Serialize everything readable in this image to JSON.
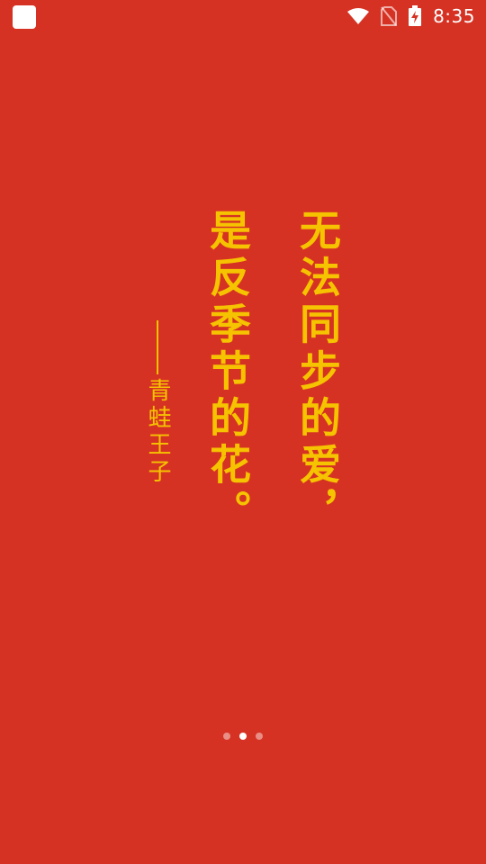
{
  "status_bar": {
    "time": "8:35",
    "icons": [
      "app-square-icon",
      "wifi-icon",
      "no-sim-icon",
      "battery-charging-icon"
    ]
  },
  "poem": {
    "line1": "无法同步的爱，",
    "line2": "是反季节的花。",
    "author": "青蛙王子"
  },
  "pager": {
    "count": 3,
    "active_index": 1
  },
  "colors": {
    "background": "#d63224",
    "text": "#f5c300"
  }
}
